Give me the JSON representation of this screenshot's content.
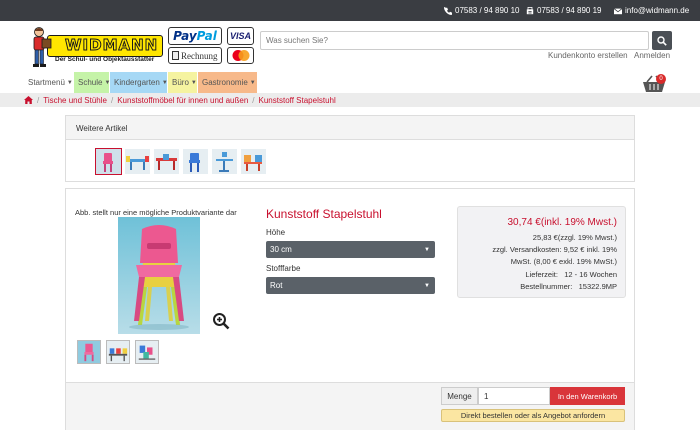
{
  "topbar": {
    "phone": "07583 / 94 890 10",
    "fax": "07583 / 94 890 19",
    "email": "info@widmann.de"
  },
  "logo": {
    "title": "WIDMANN",
    "subtitle": "Der Schul- und Objektausstatter"
  },
  "payments": {
    "paypal_a": "Pay",
    "paypal_b": "Pal",
    "visa": "VISA",
    "rechnung": "Rechnung"
  },
  "search": {
    "placeholder": "Was suchen Sie?"
  },
  "account": {
    "create": "Kundenkonto erstellen",
    "login": "Anmelden"
  },
  "nav": {
    "items": [
      "Startmenü",
      "Schule",
      "Kindergarten",
      "Büro",
      "Gastronomie"
    ]
  },
  "cart": {
    "count": "0"
  },
  "breadcrumb": {
    "items": [
      "Tische und Stühle",
      "Kunststoffmöbel für innen und außen",
      "Kunststoff Stapelstuhl"
    ]
  },
  "more_articles": {
    "title": "Weitere Artikel"
  },
  "product": {
    "image_note": "Abb. stellt nur eine mögliche Produktvariante dar",
    "title": "Kunststoff Stapelstuhl",
    "height_label": "Höhe",
    "height_value": "30 cm",
    "color_label": "Stofffarbe",
    "color_value": "Rot"
  },
  "price": {
    "main": "30,74 €(inkl. 19% Mwst.)",
    "net": "25,83 €(zzgl. 19% Mwst.)",
    "shipping_1": "zzgl. Versandkosten: 9,52 € inkl. 19%",
    "shipping_2": "MwSt. (8,00 € exkl. 19% MwSt.)",
    "delivery_label": "Lieferzeit:",
    "delivery_value": "12 - 16 Wochen",
    "order_no_label": "Bestellnummer:",
    "order_no_value": "15322.9MP"
  },
  "purchase": {
    "qty_label": "Menge",
    "qty_value": "1",
    "cart_button": "In den Warenkorb",
    "order_button": "Direkt bestellen oder als Angebot anfordern"
  },
  "colors": {
    "accent": "#c8102e",
    "topbar": "#3a3d42",
    "cart_button": "#d9353a"
  }
}
